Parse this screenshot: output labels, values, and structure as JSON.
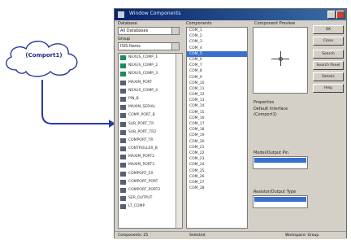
{
  "cloud": {
    "label": "(Comport1)"
  },
  "window": {
    "title": "Window Components"
  },
  "left_panel": {
    "label1": "Database",
    "database": "All Databases",
    "label2": "Group",
    "group": "ISIS Items",
    "components": [
      "NEXUS_COMP_1",
      "NEXUS_COMP_2",
      "NEXUS_COMP_3",
      "MAXIM_PORT",
      "NEXUS_COMP_4",
      "PIN_B",
      "MAXIM_SERIAL",
      "COMP_PORT_B",
      "SUB_PORT_TR",
      "SUB_PORT_TR2",
      "COMPORT_TR",
      "CONTROLLER_B",
      "MAXIM_PORT2",
      "MAXIM_PORT3",
      "COMPORT_EX",
      "COMPORT_PORT",
      "COMPORT_PORT2",
      "SER_OUTPUT",
      "LT_COMP"
    ]
  },
  "middle_panel": {
    "label": "Components",
    "items": [
      "COM_1",
      "COM_2",
      "COM_3",
      "COM_4",
      "COM_5",
      "COM_6",
      "COM_7",
      "COM_8",
      "COM_9",
      "COM_10",
      "COM_11",
      "COM_12",
      "COM_13",
      "COM_14",
      "COM_15",
      "COM_16",
      "COM_17",
      "COM_18",
      "COM_19",
      "COM_20",
      "COM_21",
      "COM_22",
      "COM_23",
      "COM_24",
      "COM_25",
      "COM_26",
      "COM_27",
      "COM_28"
    ],
    "selected_index": 4
  },
  "preview": {
    "label": "Component Preview"
  },
  "buttons": [
    "OK",
    "Close",
    "Search",
    "Search Panel",
    "Details",
    "Help"
  ],
  "info": {
    "label": "Properties",
    "line1": "Default Interface",
    "line2": "(Comport1)"
  },
  "box1_label": "Model/Output Pin",
  "box2_label": "Resistor/Output Type",
  "status": {
    "left": "Components: 25",
    "mid": "Selected",
    "right": "Workspace: Group"
  }
}
